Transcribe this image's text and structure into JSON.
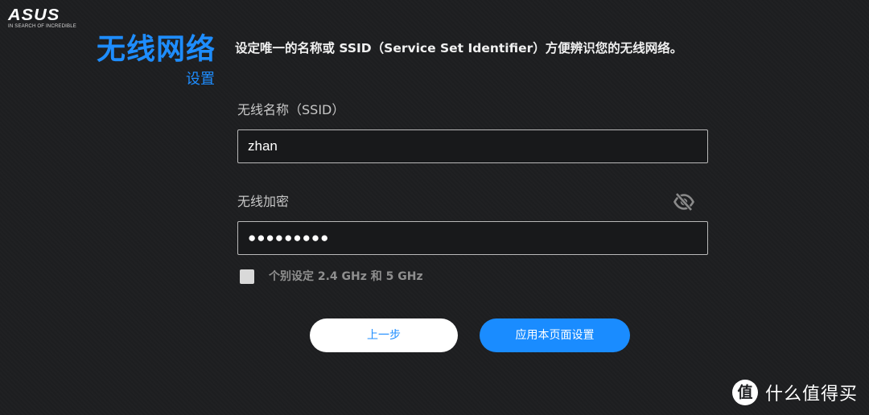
{
  "logo": {
    "brand": "ASUS",
    "tagline": "IN SEARCH OF INCREDIBLE"
  },
  "header": {
    "title": "无线网络",
    "subtitle": "设置",
    "description": "设定唯一的名称或 SSID（Service Set Identifier）方便辨识您的无线网络。"
  },
  "form": {
    "ssid": {
      "label": "无线名称（SSID）",
      "value": "zhan"
    },
    "password": {
      "label": "无线加密",
      "masked_value": "●●●●●●●●●",
      "visibility_icon": "eye-off-icon"
    },
    "separate_bands": {
      "label": "个别设定 2.4 GHz 和 5 GHz",
      "checked": false
    }
  },
  "buttons": {
    "back_label": "上一步",
    "apply_label": "应用本页面设置"
  },
  "watermark": {
    "badge": "值",
    "text": "什么值得买"
  },
  "colors": {
    "background": "#1d1e20",
    "accent": "#1e8dff",
    "input_border": "#b9b9b9",
    "muted_text": "#8f8f8f"
  }
}
